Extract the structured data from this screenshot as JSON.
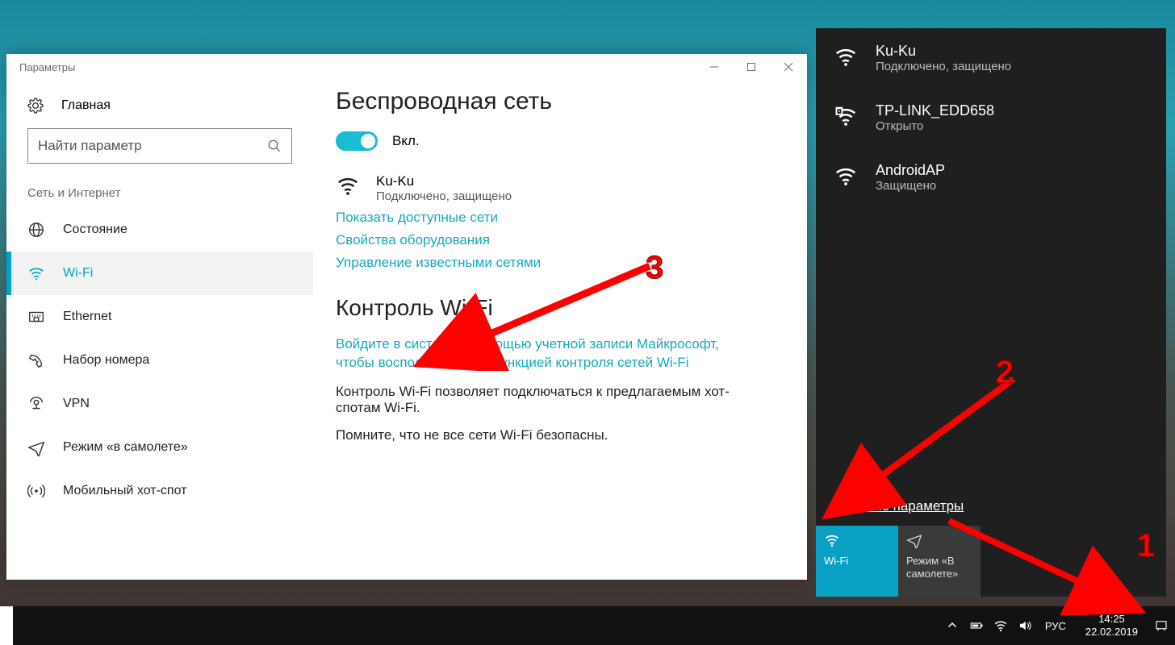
{
  "window": {
    "title": "Параметры",
    "home": "Главная",
    "search_placeholder": "Найти параметр",
    "category": "Сеть и Интернет",
    "nav": {
      "status": "Состояние",
      "wifi": "Wi-Fi",
      "ethernet": "Ethernet",
      "dialup": "Набор номера",
      "vpn": "VPN",
      "airplane": "Режим «в самолете»",
      "hotspot": "Мобильный хот-спот"
    }
  },
  "main": {
    "title": "Беспроводная сеть",
    "toggle_label": "Вкл.",
    "connected_name": "Ku-Ku",
    "connected_status": "Подключено, защищено",
    "link_show_networks": "Показать доступные сети",
    "link_hw_props": "Свойства оборудования",
    "link_known": "Управление известными сетями",
    "control_title": "Контроль Wi-Fi",
    "link_signin": "Войдите в систему с помощью учетной записи Майкрософт, чтобы воспользоваться функцией контроля сетей Wi-Fi",
    "plain_1": "Контроль Wi-Fi позволяет подключаться к предлагаемым хот-спотам Wi-Fi.",
    "plain_2": "Помните, что не все сети Wi-Fi безопасны."
  },
  "flyout": {
    "net1_name": "Ku-Ku",
    "net1_stat": "Подключено, защищено",
    "net2_name": "TP-LINK_EDD658",
    "net2_stat": "Открыто",
    "net3_name": "AndroidAP",
    "net3_stat": "Защищено",
    "net_params": "Сетевые параметры",
    "tile_wifi": "Wi-Fi",
    "tile_airplane": "Режим «В самолете»"
  },
  "taskbar": {
    "lang": "РУС",
    "time": "14:25",
    "date": "22.02.2019"
  },
  "annotations": {
    "a1": "1",
    "a2": "2",
    "a3": "3"
  }
}
